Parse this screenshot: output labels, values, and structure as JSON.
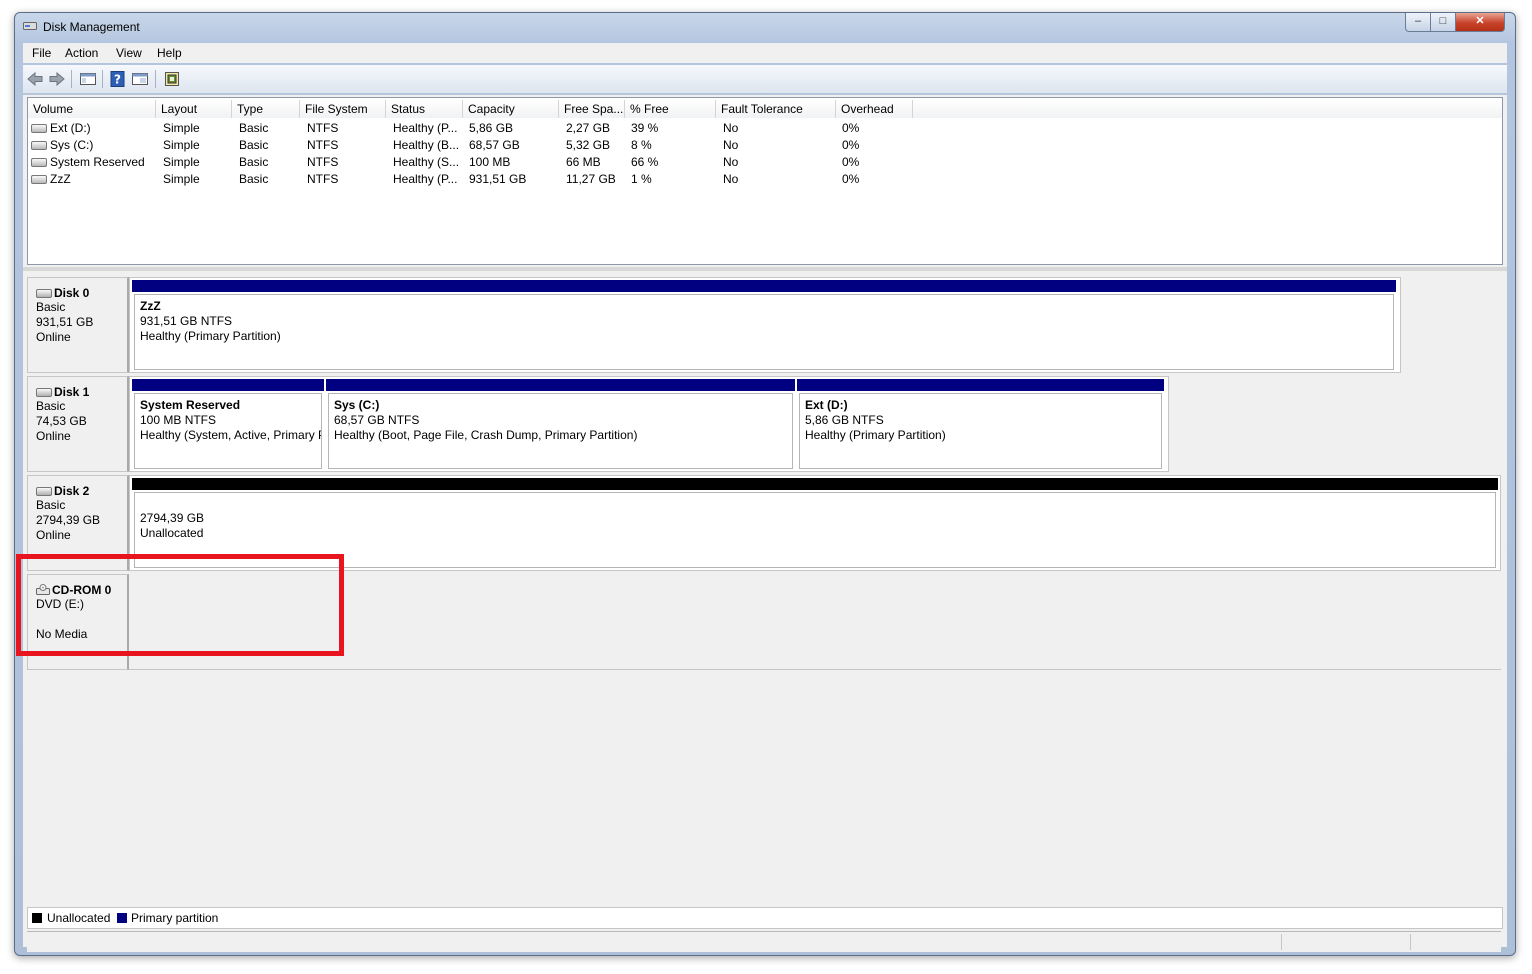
{
  "window": {
    "title": "Disk Management",
    "min": "‒",
    "max": "□",
    "close": "✕"
  },
  "menu": [
    "File",
    "Action",
    "View",
    "Help"
  ],
  "toolbar": {
    "icons": [
      "back-arrow-icon",
      "forward-arrow-icon",
      "console-tree-icon",
      "help-icon",
      "properties-icon",
      "settings-icon"
    ]
  },
  "volume_list": {
    "columns": [
      "Volume",
      "Layout",
      "Type",
      "File System",
      "Status",
      "Capacity",
      "Free Spa...",
      "% Free",
      "Fault Tolerance",
      "Overhead"
    ],
    "rows": [
      [
        "Ext (D:)",
        "Simple",
        "Basic",
        "NTFS",
        "Healthy (P...",
        "5,86 GB",
        "2,27 GB",
        "39 %",
        "No",
        "0%"
      ],
      [
        "Sys (C:)",
        "Simple",
        "Basic",
        "NTFS",
        "Healthy (B...",
        "68,57 GB",
        "5,32 GB",
        "8 %",
        "No",
        "0%"
      ],
      [
        "System Reserved",
        "Simple",
        "Basic",
        "NTFS",
        "Healthy (S...",
        "100 MB",
        "66 MB",
        "66 %",
        "No",
        "0%"
      ],
      [
        "ZzZ",
        "Simple",
        "Basic",
        "NTFS",
        "Healthy (P...",
        "931,51 GB",
        "11,27 GB",
        "1 %",
        "No",
        "0%"
      ]
    ]
  },
  "disks": [
    {
      "name": "Disk 0",
      "type": "Basic",
      "size": "931,51 GB",
      "state": "Online",
      "partitions": [
        {
          "name": "ZzZ",
          "detail": "931,51 GB NTFS",
          "status": "Healthy (Primary Partition)"
        }
      ]
    },
    {
      "name": "Disk 1",
      "type": "Basic",
      "size": "74,53 GB",
      "state": "Online",
      "partitions": [
        {
          "name": "System Reserved",
          "detail": "100 MB NTFS",
          "status": "Healthy (System, Active, Primary P"
        },
        {
          "name": "Sys  (C:)",
          "detail": "68,57 GB NTFS",
          "status": "Healthy (Boot, Page File, Crash Dump, Primary Partition)"
        },
        {
          "name": "Ext  (D:)",
          "detail": "5,86 GB NTFS",
          "status": "Healthy (Primary Partition)"
        }
      ]
    },
    {
      "name": "Disk 2",
      "type": "Basic",
      "size": "2794,39 GB",
      "state": "Online",
      "partitions": [
        {
          "detail": "2794,39 GB",
          "status": "Unallocated"
        }
      ]
    },
    {
      "name": "CD-ROM 0",
      "type": "DVD (E:)",
      "state": "No Media"
    }
  ],
  "legend": [
    {
      "label": "Unallocated",
      "color": "#000000"
    },
    {
      "label": "Primary partition",
      "color": "#000080"
    }
  ],
  "colors": {
    "primary": "#000080",
    "unallocated": "#000000",
    "highlight": "#e8141e"
  }
}
